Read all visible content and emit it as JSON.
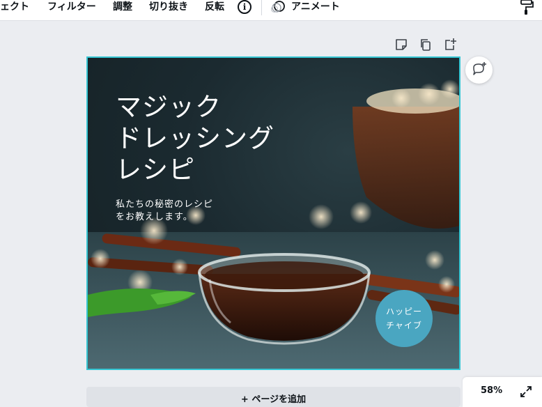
{
  "toolbar": {
    "items": [
      {
        "label": "ェクト"
      },
      {
        "label": "フィルター"
      },
      {
        "label": "調整"
      },
      {
        "label": "切り抜き"
      },
      {
        "label": "反転"
      }
    ],
    "info_icon_glyph": "i",
    "animate_label": "アニメート",
    "icons": [
      "info-icon",
      "animate-icon",
      "paint-roller-icon"
    ]
  },
  "page_actions": {
    "icons": [
      "add-note-icon",
      "duplicate-page-icon",
      "add-page-icon"
    ]
  },
  "design": {
    "headline": "マジック\nドレッシング\nレシピ",
    "subtext": "私たちの秘密のレシピ\nをお教えします。",
    "badge": "ハッピー\nチャイブ",
    "selection_color": "#35c6d3",
    "badge_color": "#4aa6c1"
  },
  "comment_icon": "add-comment-icon",
  "footer": {
    "add_page_label": "+ ページを追加",
    "zoom": "58%",
    "expand_icon": "fullscreen-icon"
  }
}
